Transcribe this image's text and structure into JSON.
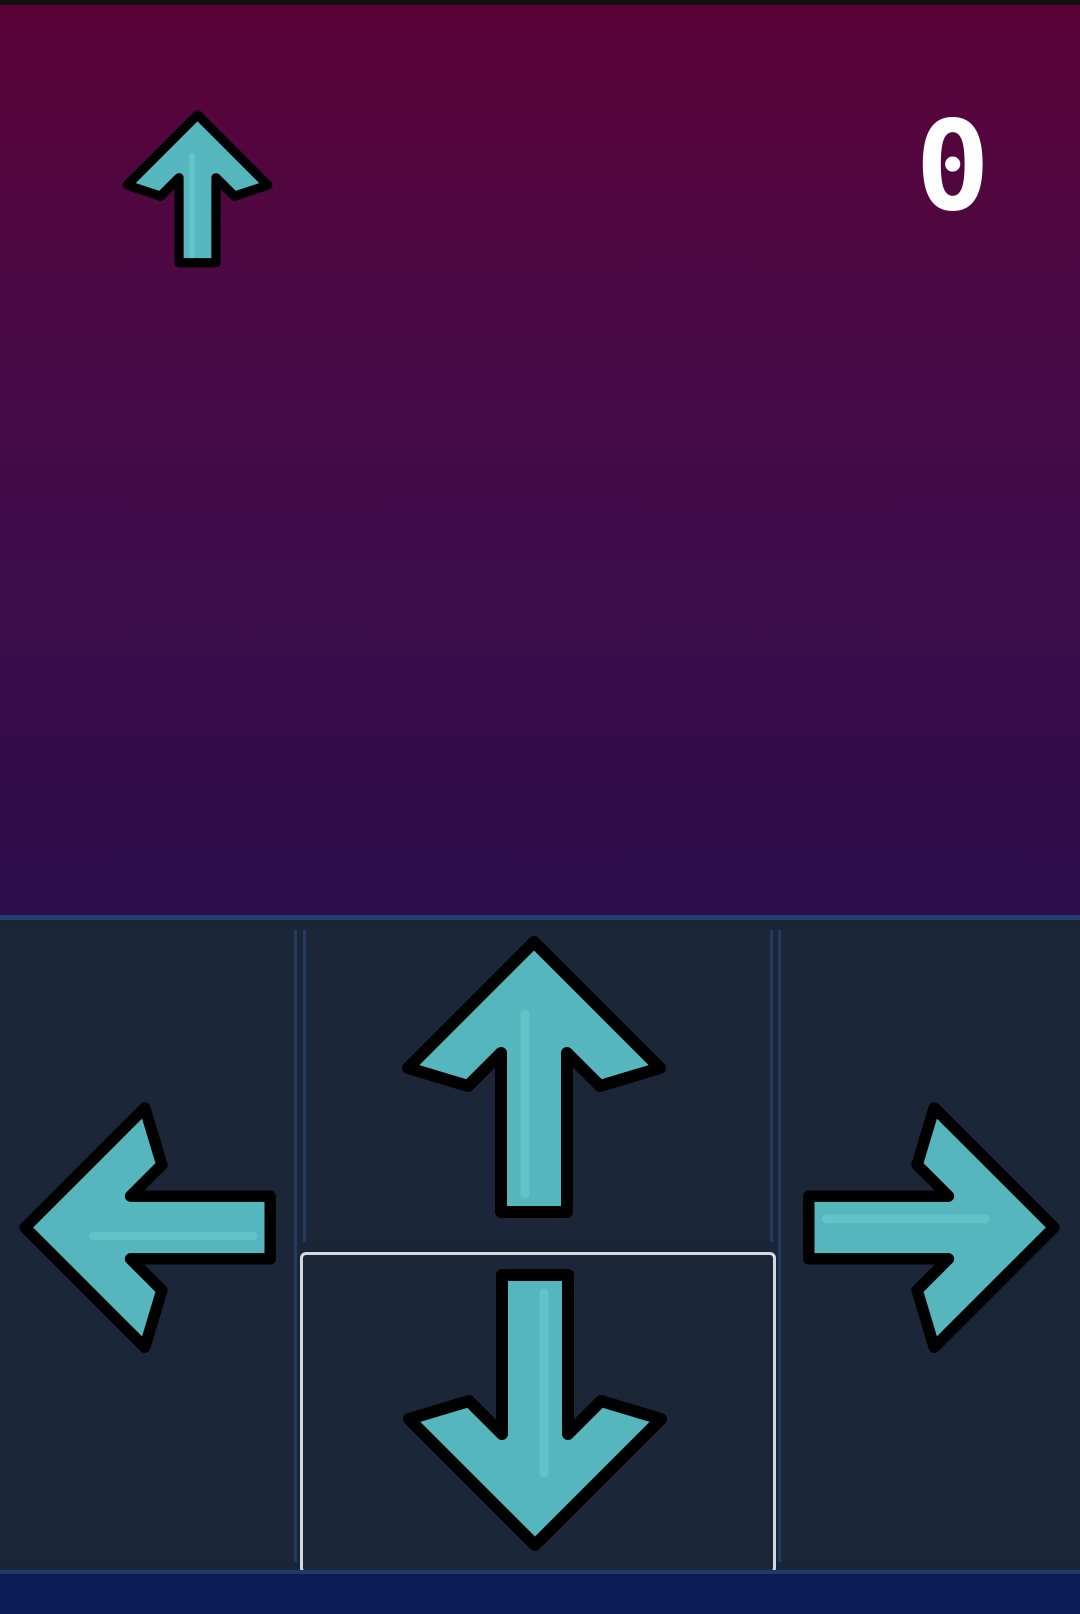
{
  "game": {
    "score": "0",
    "target_arrow_icon": "arrow-up-icon"
  },
  "controls": {
    "left_icon": "arrow-left-icon",
    "up_icon": "arrow-up-icon",
    "down_icon": "arrow-down-icon",
    "right_icon": "arrow-right-icon",
    "selected": "down"
  },
  "colors": {
    "arrow_fill": "#55b6bd",
    "arrow_outline": "#000000",
    "panel_background": "#1b2538",
    "selection_border": "#d4d9e0",
    "playfield_top": "#5a0238",
    "playfield_bottom": "#2e0d4c",
    "score_text": "#ffffff"
  }
}
